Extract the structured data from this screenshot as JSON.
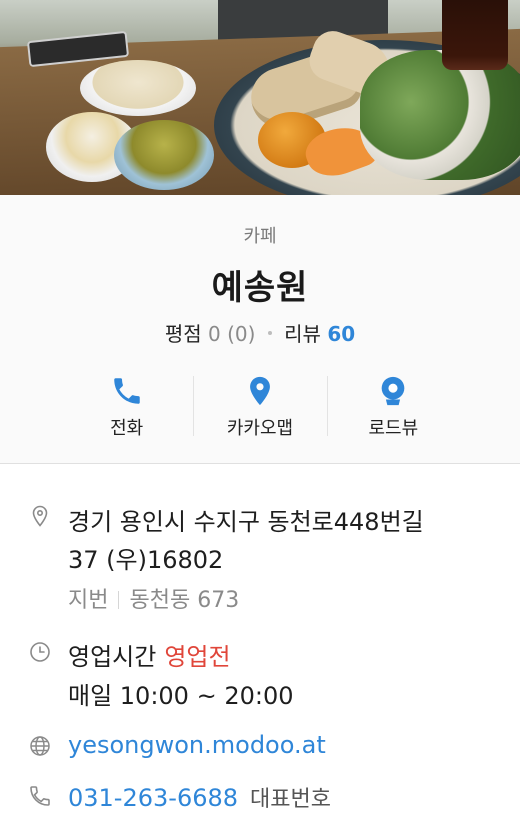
{
  "hero": {
    "photo_description": "food-photo"
  },
  "place": {
    "category": "카페",
    "name": "예송원",
    "rating_label": "평점",
    "rating_value": "0 (0)",
    "review_label": "리뷰",
    "review_count": "60"
  },
  "actions": [
    {
      "label": "전화",
      "icon": "phone-icon"
    },
    {
      "label": "카카오맵",
      "icon": "map-pin-icon"
    },
    {
      "label": "로드뷰",
      "icon": "roadview-icon"
    }
  ],
  "details": {
    "address_line1": "경기 용인시 수지구 동천로448번길",
    "address_line2": "37 (우)16802",
    "jibun_label": "지번",
    "jibun_value": "동천동 673",
    "hours_label": "영업시간",
    "hours_status": "영업전",
    "hours_value": "매일 10:00 ~ 20:00",
    "website": "yesongwon.modoo.at",
    "phone": "031-263-6688",
    "phone_note": "대표번호"
  },
  "colors": {
    "accent": "#2f86d8",
    "status_closed": "#e0463a",
    "muted_text": "#8a8a8a"
  }
}
